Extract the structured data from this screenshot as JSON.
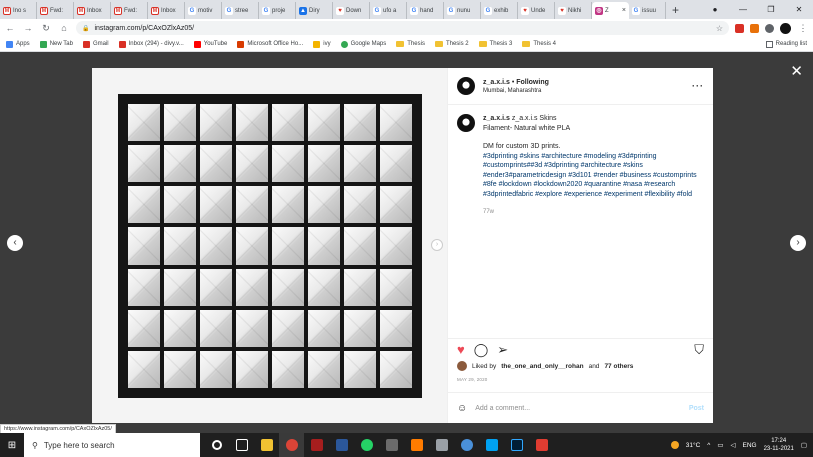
{
  "browser": {
    "tabs": [
      {
        "label": "Ino s",
        "icon": "gmail-icon"
      },
      {
        "label": "Fwd:",
        "icon": "gmail-icon"
      },
      {
        "label": "Inbox",
        "icon": "gmail-icon"
      },
      {
        "label": "Fwd:",
        "icon": "gmail-icon"
      },
      {
        "label": "Inbox",
        "icon": "gmail-icon"
      },
      {
        "label": "motiv",
        "icon": "google-icon"
      },
      {
        "label": "stree",
        "icon": "google-icon"
      },
      {
        "label": "proje",
        "icon": "google-icon"
      },
      {
        "label": "Diry",
        "icon": "drive-icon"
      },
      {
        "label": "Down",
        "icon": "heart-icon"
      },
      {
        "label": "ufo a",
        "icon": "google-icon"
      },
      {
        "label": "hand",
        "icon": "google-icon"
      },
      {
        "label": "nunu",
        "icon": "google-icon"
      },
      {
        "label": "exhib",
        "icon": "google-icon"
      },
      {
        "label": "Unde",
        "icon": "heart-icon"
      },
      {
        "label": "Nikhi",
        "icon": "heart-icon"
      },
      {
        "label": "Z",
        "icon": "instagram-icon",
        "active": true
      },
      {
        "label": "issuu",
        "icon": "google-icon"
      }
    ],
    "url": "instagram.com/p/CAxOZlxAz05/",
    "bookmarks": [
      {
        "label": "Apps"
      },
      {
        "label": "New Tab"
      },
      {
        "label": "Gmail"
      },
      {
        "label": "Inbox (294) - divy.v..."
      },
      {
        "label": "YouTube"
      },
      {
        "label": "Microsoft Office Ho..."
      },
      {
        "label": "ivy"
      },
      {
        "label": "Google Maps"
      },
      {
        "label": "Thesis"
      },
      {
        "label": "Thesis 2"
      },
      {
        "label": "Thesis 3"
      },
      {
        "label": "Thesis 4"
      }
    ],
    "reading_list": "Reading list",
    "status_url": "https://www.instagram.com/p/CAxOZlxAz05/"
  },
  "post": {
    "username": "z_a.x.i.s",
    "following": "Following",
    "separator": "•",
    "location": "Mumbai, Maharashtra",
    "caption_user": "z_a.x.i.s",
    "caption_line1": "z_a.x.i.s Skins",
    "caption_line2": "Filament- Natural white PLA",
    "caption_line3": "DM for custom 3D prints.",
    "hashtags": "#3dprinting #skins #architecture #modeling #3d#printing #customprints##3d #3dprinting #architecture #skins #ender3#parametricdesign #3d101 #render #business #customprints #8fe #lockdown #lockdown2020 #quarantine #nasa #research #3dprintedfabric #explore #experience #experiment #flexibility #fold",
    "time_ago": "77w",
    "liked_by_prefix": "Liked by",
    "liked_by_user": "the_one_and_only__rohan",
    "liked_by_and": "and",
    "liked_by_others": "77 others",
    "date": "MAY 29, 2020",
    "comment_placeholder": "Add a comment...",
    "post_label": "Post",
    "photo_grid": {
      "columns": 8,
      "rows": 7
    }
  },
  "taskbar": {
    "search_placeholder": "Type here to search",
    "temperature": "31°C",
    "language": "ENG",
    "time": "17:24",
    "date": "23-11-2021"
  },
  "colors": {
    "hashtag": "#00376b",
    "like_heart": "#ed4956",
    "overlay": "#3b3b3b"
  }
}
